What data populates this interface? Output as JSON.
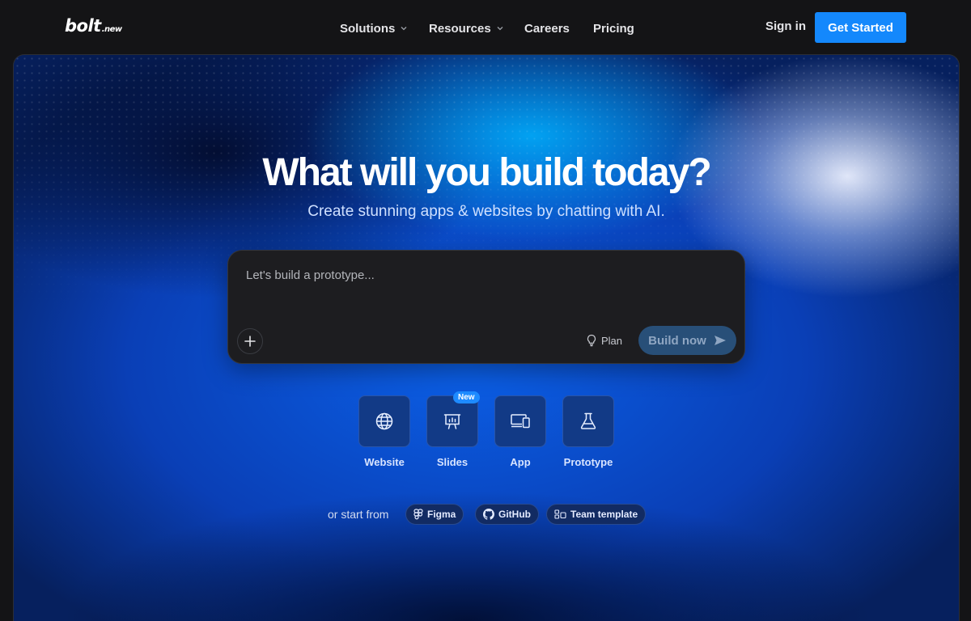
{
  "brand": {
    "name": "bolt",
    "suffix": ".new"
  },
  "nav": {
    "items": [
      {
        "label": "Solutions",
        "dropdown": true
      },
      {
        "label": "Resources",
        "dropdown": true
      },
      {
        "label": "Careers",
        "dropdown": false
      },
      {
        "label": "Pricing",
        "dropdown": false
      }
    ],
    "sign_in": "Sign in",
    "get_started": "Get Started"
  },
  "hero": {
    "title": "What will you build today?",
    "subtitle": "Create stunning apps & websites by chatting with AI."
  },
  "prompt": {
    "placeholder": "Let's build a prototype...",
    "value": "",
    "plan_label": "Plan",
    "build_label": "Build now"
  },
  "tiles": [
    {
      "label": "Website",
      "icon": "globe-icon"
    },
    {
      "label": "Slides",
      "icon": "presentation-icon",
      "badge": "New"
    },
    {
      "label": "App",
      "icon": "devices-icon"
    },
    {
      "label": "Prototype",
      "icon": "flask-icon"
    }
  ],
  "start_from": {
    "lead": "or start from",
    "options": [
      {
        "label": "Figma",
        "icon": "figma-icon"
      },
      {
        "label": "GitHub",
        "icon": "github-icon"
      },
      {
        "label": "Team template",
        "icon": "template-icon"
      }
    ]
  },
  "colors": {
    "accent": "#1488fc",
    "page_bg": "#141416",
    "prompt_bg": "#1d1d20",
    "tile_bg": "#123a86",
    "build_button_bg": "#284f78"
  }
}
